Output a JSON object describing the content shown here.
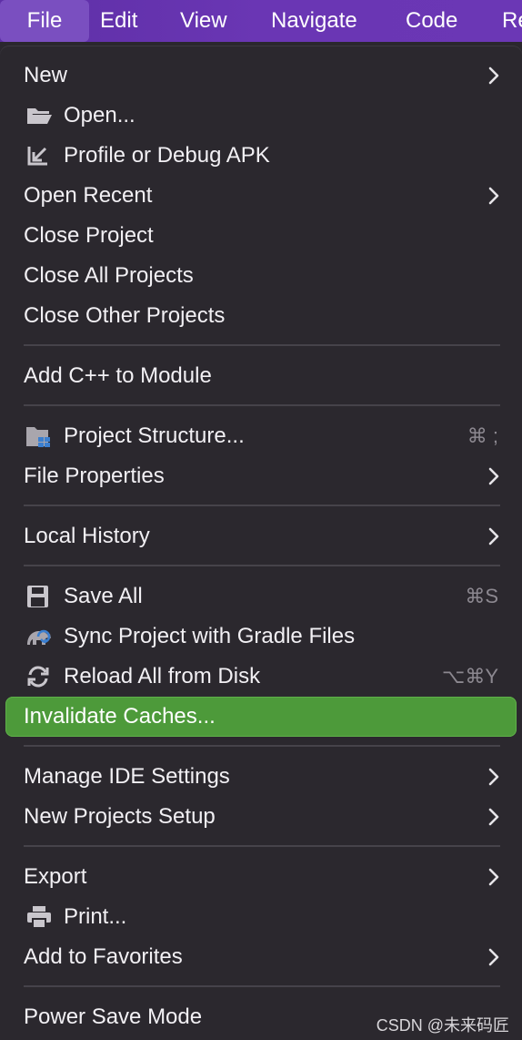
{
  "menubar": {
    "items": [
      "File",
      "Edit",
      "View",
      "Navigate",
      "Code",
      "Re"
    ]
  },
  "menu": {
    "items": [
      {
        "label": "New",
        "icon": "",
        "submenu": true,
        "shortcut": ""
      },
      {
        "label": "Open...",
        "icon": "folder-open-icon",
        "submenu": false,
        "shortcut": ""
      },
      {
        "label": "Profile or Debug APK",
        "icon": "import-arrow-icon",
        "submenu": false,
        "shortcut": ""
      },
      {
        "label": "Open Recent",
        "icon": "",
        "submenu": true,
        "shortcut": ""
      },
      {
        "label": "Close Project",
        "icon": "",
        "submenu": false,
        "shortcut": ""
      },
      {
        "label": "Close All Projects",
        "icon": "",
        "submenu": false,
        "shortcut": ""
      },
      {
        "label": "Close Other Projects",
        "icon": "",
        "submenu": false,
        "shortcut": ""
      },
      {
        "label": "Add C++ to Module",
        "icon": "",
        "submenu": false,
        "shortcut": ""
      },
      {
        "label": "Project Structure...",
        "icon": "project-structure-icon",
        "submenu": false,
        "shortcut": "⌘ ;"
      },
      {
        "label": "File Properties",
        "icon": "",
        "submenu": true,
        "shortcut": ""
      },
      {
        "label": "Local History",
        "icon": "",
        "submenu": true,
        "shortcut": ""
      },
      {
        "label": "Save All",
        "icon": "save-icon",
        "submenu": false,
        "shortcut": "⌘S"
      },
      {
        "label": "Sync Project with Gradle Files",
        "icon": "gradle-sync-icon",
        "submenu": false,
        "shortcut": ""
      },
      {
        "label": "Reload All from Disk",
        "icon": "reload-icon",
        "submenu": false,
        "shortcut": "⌥⌘Y"
      },
      {
        "label": "Invalidate Caches...",
        "icon": "",
        "submenu": false,
        "shortcut": "",
        "highlighted": true
      },
      {
        "label": "Manage IDE Settings",
        "icon": "",
        "submenu": true,
        "shortcut": ""
      },
      {
        "label": "New Projects Setup",
        "icon": "",
        "submenu": true,
        "shortcut": ""
      },
      {
        "label": "Export",
        "icon": "",
        "submenu": true,
        "shortcut": ""
      },
      {
        "label": "Print...",
        "icon": "printer-icon",
        "submenu": false,
        "shortcut": ""
      },
      {
        "label": "Add to Favorites",
        "icon": "",
        "submenu": true,
        "shortcut": ""
      },
      {
        "label": "Power Save Mode",
        "icon": "",
        "submenu": false,
        "shortcut": ""
      }
    ]
  },
  "watermark": "CSDN @未来码匠",
  "colors": {
    "menubar": "#6a36b4",
    "menu_bg": "#2b282e",
    "highlight": "#4d9a3a",
    "text": "#f2f0f4",
    "shortcut": "#8c8890"
  }
}
